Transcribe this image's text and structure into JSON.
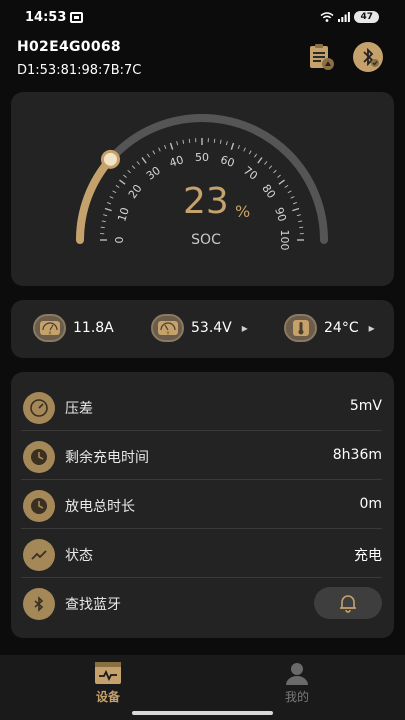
{
  "status_bar": {
    "time": "14:53",
    "battery_level": "47",
    "icons": [
      "message-icon",
      "wifi-icon",
      "signal-icon",
      "battery-icon"
    ]
  },
  "device": {
    "name": "H02E4G0068",
    "mac": "D1:53:81:98:7B:7C"
  },
  "header_actions": [
    "report-icon",
    "bluetooth-icon"
  ],
  "gauge": {
    "value": "23",
    "unit": "%",
    "label": "SOC",
    "fill_fraction": 0.23,
    "ticks": [
      "0",
      "10",
      "20",
      "30",
      "40",
      "50",
      "60",
      "70",
      "80",
      "90",
      "100"
    ],
    "accent_color": "#c5a26c",
    "track_color": "#555555"
  },
  "metrics": [
    {
      "icon": "ammeter-icon",
      "value": "11.8A",
      "has_chevron": false
    },
    {
      "icon": "voltmeter-icon",
      "value": "53.4V",
      "has_chevron": true
    },
    {
      "icon": "thermometer-icon",
      "value": "24°C",
      "has_chevron": true
    }
  ],
  "details": [
    {
      "icon": "pressure-gauge-icon",
      "label": "压差",
      "value": "5mV"
    },
    {
      "icon": "clock-icon",
      "label": "剩余充电时间",
      "value": "8h36m"
    },
    {
      "icon": "clock-icon",
      "label": "放电总时长",
      "value": "0m"
    },
    {
      "icon": "trend-chart-icon",
      "label": "状态",
      "value": "充电"
    },
    {
      "icon": "bluetooth-icon",
      "label": "查找蓝牙",
      "value": "",
      "action_icon": "bell-icon"
    }
  ],
  "bottom_nav": [
    {
      "label": "设备",
      "icon": "device-icon",
      "active": true
    },
    {
      "label": "我的",
      "icon": "user-icon",
      "active": false
    }
  ],
  "colors": {
    "background": "#0c0c0c",
    "card": "#232323",
    "accent": "#c5a26c"
  }
}
